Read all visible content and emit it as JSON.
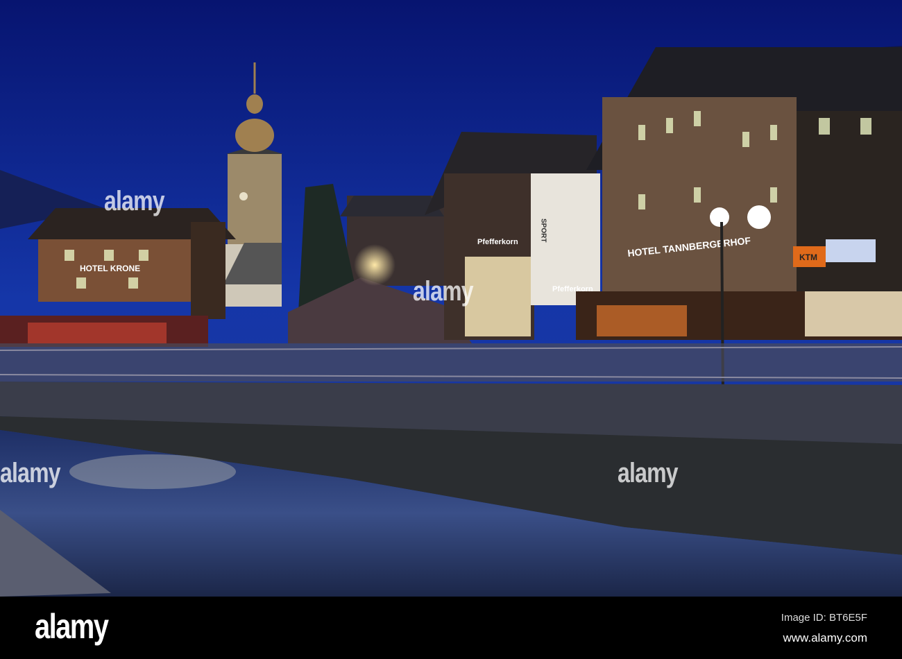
{
  "scene": {
    "signs": {
      "hotel_krone": "HOTEL KRONE",
      "hotel_tannberger": "HOTEL TANNBERGERHOF",
      "pfefferkorn_top": "Pfefferkorn",
      "pfefferkorn_bottom": "Pfefferkorn",
      "sport": "SPORT",
      "ktm": "KTM"
    },
    "colors": {
      "sky_top": "#0a1a7a",
      "sky_bottom": "#1a3fb0",
      "water": "#2a3f7a"
    }
  },
  "watermark": {
    "text": "alamy"
  },
  "footer": {
    "logo": "alamy",
    "image_id": "Image ID: BT6E5F",
    "website": "www.alamy.com"
  }
}
